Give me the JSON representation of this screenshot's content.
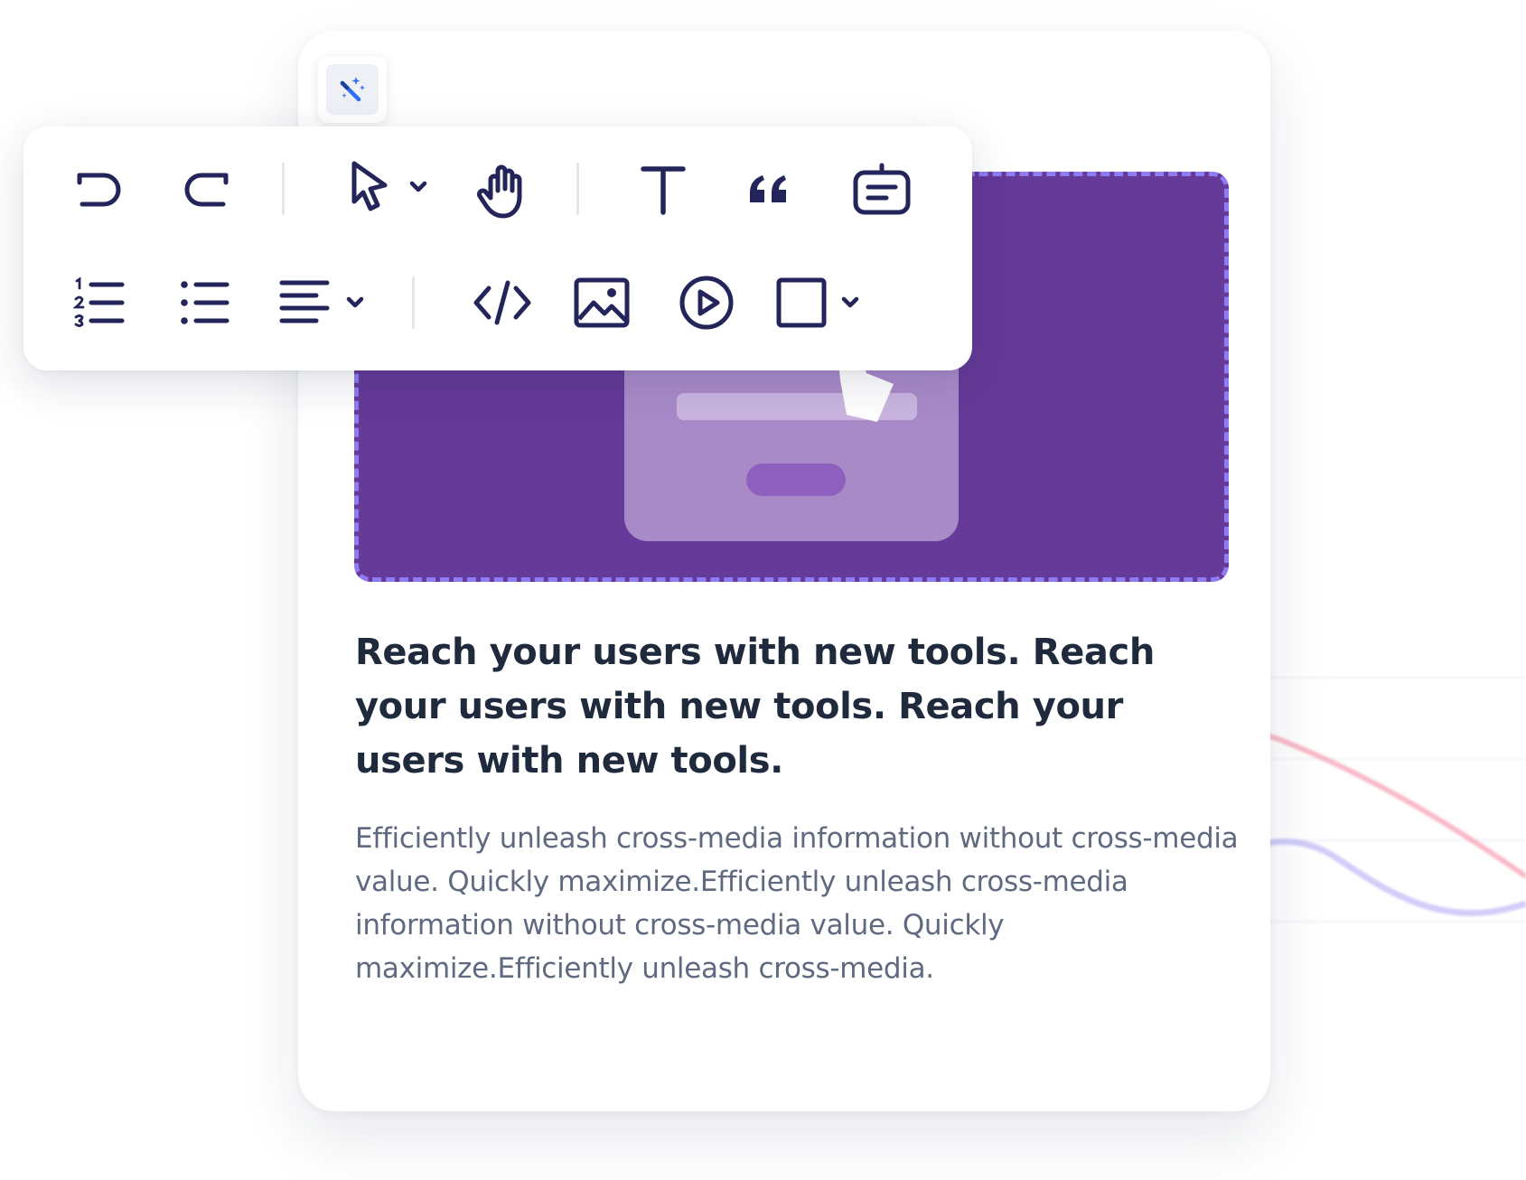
{
  "card": {
    "headline": "Reach your users with new tools. Reach your users with new tools. Reach your users with new tools.",
    "body": "Efficiently unleash cross-media information without cross-media value. Quickly maximize.Efficiently unleash cross-media information without cross-media value. Quickly maximize.Efficiently unleash cross-media."
  },
  "magic_chip": {
    "icon": "magic-wand-icon"
  },
  "toolbar": {
    "rows": [
      [
        "undo-icon",
        "redo-icon",
        "pointer-icon",
        "hand-icon",
        "text-icon",
        "quote-icon",
        "comment-icon"
      ],
      [
        "numbered-list-icon",
        "bullet-list-icon",
        "align-left-icon",
        "code-icon",
        "image-icon",
        "video-icon",
        "shape-square-icon"
      ]
    ]
  },
  "colors": {
    "icon": "#23255a",
    "hero_bg": "#653a98",
    "hero_dash": "#8f7cf2",
    "headline": "#1f2a3c",
    "body": "#5f6a80",
    "chip_icon": "#2f6ff0",
    "line_red": "#f25a7a",
    "line_blue": "#8a7cf0"
  }
}
